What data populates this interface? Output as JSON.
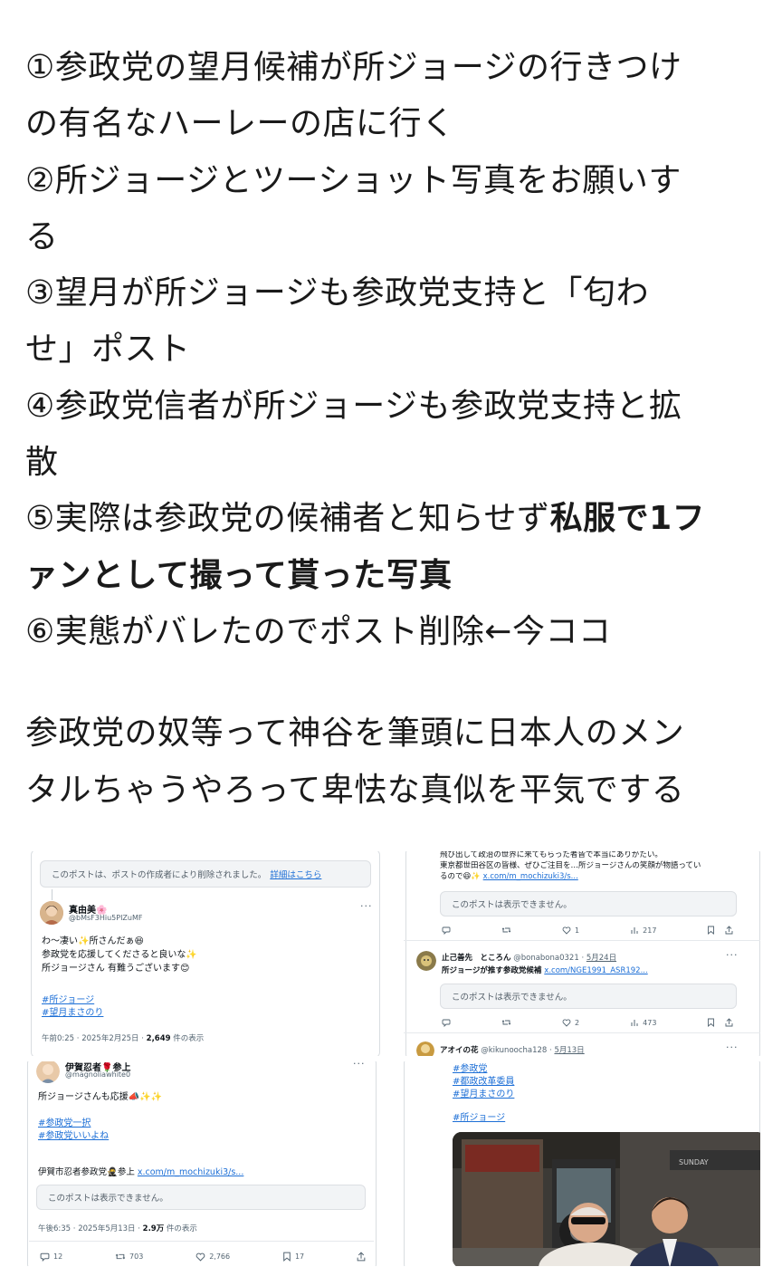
{
  "post": {
    "lines": [
      "①参政党の望月候補が所ジョージの行きつけ",
      "の有名なハーレーの店に行く",
      "②所ジョージとツーショット写真をお願いす",
      "る",
      "③望月が所ジョージも参政党支持と「匂わ",
      "せ」ポスト",
      "④参政党信者が所ジョージも参政党支持と拡",
      "散"
    ],
    "line5_normal": "⑤実際は参政党の候補者と知らせず",
    "line5_bold": "私服で1フ",
    "line6_bold": "ァンとして撮って貰った写真",
    "line7": "⑥実態がバレたのでポスト削除←今ココ",
    "para2_lines": [
      "参政党の奴等って神谷を筆頭に日本人のメン",
      "タルちゃうやろって卑怯な真似を平気でする"
    ]
  },
  "p1": {
    "notice": "このポストは、ポストの作成者により削除されました。",
    "notice_link": "詳細はこちら",
    "name": "真由美🌸",
    "handle": "@bMsF3Hiu5PIZuMF",
    "body": [
      "わ〜凄い✨所さんだぁ😆",
      "参政党を応援してくださると良いな✨",
      "所ジョージさん 有難うございます😊"
    ],
    "tags": [
      "#所ジョージ",
      "#望月まさのり"
    ],
    "meta_time": "午前0:25 · 2025年2月25日 · ",
    "meta_views": "2,649",
    "meta_suffix": " 件の表示"
  },
  "p2": {
    "top_lines": [
      "飛び出して政治の世界に来てもらった者皆で本当にありがたい。",
      "東京都世田谷区の皆様、ぜひご注目を…所ジョージさんの笑顔が物語ってい"
    ],
    "top_line3": "るので😆✨ ",
    "top_link": "x.com/m_mochizuki3/s...",
    "notice": "このポストは表示できません。",
    "a1": {
      "like": "1",
      "views": "217"
    },
    "user2_name": "止己善先　ところん",
    "user2_handle": "@bonabona0321",
    "user2_date": "5月24日",
    "user2_body": "所ジョージが推す参政党候補 ",
    "user2_link": "x.com/NGE1991_ASR192...",
    "notice2": "このポストは表示できません。",
    "a2": {
      "like": "2",
      "views": "473"
    },
    "user3_name": "アオイの花",
    "user3_handle": "@kikunoocha128",
    "user3_date": "5月13日"
  },
  "p3": {
    "name": "伊賀忍者🌹参上",
    "handle": "@magnoliawhite0",
    "body": "所ジョージさんも応援📣✨✨",
    "tags": [
      "#参政党一択",
      "#参政党いいよね"
    ],
    "quote_name": "伊賀市忍者参政党🥷参上 ",
    "quote_link": "x.com/m_mochizuki3/s...",
    "notice": "このポストは表示できません。",
    "meta_time": "午後6:35 · 2025年5月13日 · ",
    "meta_views": "2.9万",
    "meta_suffix": " 件の表示",
    "actions": {
      "reply": "12",
      "repost": "703",
      "like": "2,766",
      "bookmark": "17"
    }
  },
  "p4": {
    "tags": [
      "#参政党",
      "#都政改革委員",
      "#望月まさのり"
    ],
    "tag2": "#所ジョージ"
  },
  "colors": {
    "link": "#1d6fd6",
    "text": "#0f1419",
    "muted": "#536471"
  }
}
